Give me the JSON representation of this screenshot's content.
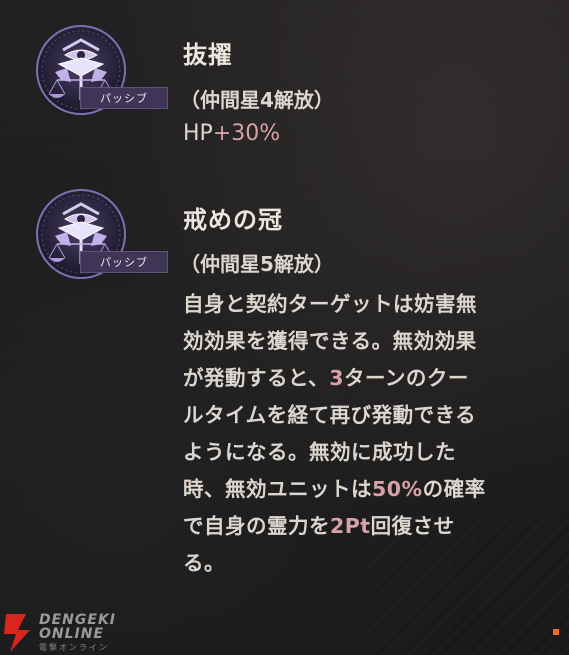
{
  "skills": [
    {
      "icon": "libra-eye-emblem-icon",
      "badge": "パッシブ",
      "title": "抜擢",
      "condition": "（仲間星4解放）",
      "effect": {
        "prefix": "HP",
        "value": "+30%"
      }
    },
    {
      "icon": "libra-eye-emblem-icon",
      "badge": "パッシブ",
      "title": "戒めの冠",
      "condition": "（仲間星5解放）",
      "description": {
        "line1": "自身と契約ターゲットは妨害無",
        "line2": "効効果を獲得できる。無効効果",
        "line3_a": "が発動すると、",
        "line3_hl": "3",
        "line3_b": "ターンのクー",
        "line4": "ルタイムを経て再び発動できる",
        "line5": "ようになる。無効に成功した",
        "line6_a": "時、無効ユニットは",
        "line6_hl": "50%",
        "line6_b": "の確率",
        "line7_a": "で自身の霊力を",
        "line7_hl": "2Pt",
        "line7_b": "回復させ",
        "line8": "る。"
      }
    }
  ],
  "watermark": {
    "line1": "DENGEKI",
    "line2": "ONLINE",
    "line3": "電撃オンライン"
  },
  "colors": {
    "highlight": "#d6a1a8",
    "badge_bg": "#3f3556",
    "emblem_purple": "#8a7bc4",
    "accent_orange": "#f06a2a"
  }
}
